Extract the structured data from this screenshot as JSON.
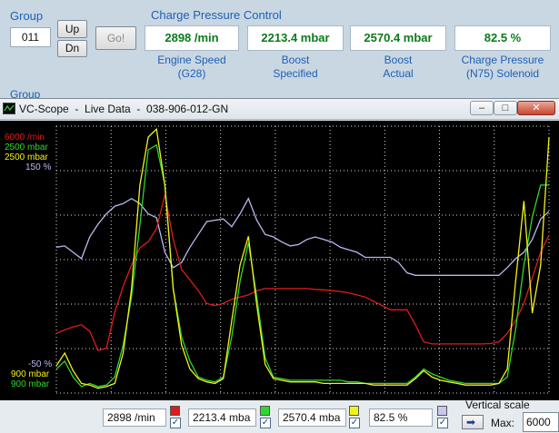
{
  "group": {
    "label": "Group",
    "value": "011",
    "up": "Up",
    "dn": "Dn",
    "go": "Go!"
  },
  "panel": {
    "title": "Charge Pressure Control",
    "fields": [
      {
        "value": "2898 /min",
        "caption1": "Engine Speed",
        "caption2": "(G28)"
      },
      {
        "value": "2213.4 mbar",
        "caption1": "Boost",
        "caption2": "Specified"
      },
      {
        "value": "2570.4 mbar",
        "caption1": "Boost",
        "caption2": "Actual"
      },
      {
        "value": "82.5 %",
        "caption1": "Charge Pressure",
        "caption2": "(N75) Solenoid"
      }
    ]
  },
  "behind_label": "Group",
  "scope": {
    "title": "VC-Scope  -  Live Data  -  038-906-012-GN",
    "app_icon": "scope-icon",
    "buttons": {
      "minimize": "–",
      "maximize": "□",
      "close": "✕"
    },
    "axis_top": [
      "6000 /min",
      "2500 mbar",
      "2500 mbar",
      "150 %"
    ],
    "axis_bottom": [
      "-50 %",
      "900 mbar",
      "900 mbar"
    ],
    "colors": {
      "rpm": "#e01b1b",
      "boost_spec": "#2fd72f",
      "boost_act": "#f2f21a",
      "n75": "#b9b9f0"
    },
    "readouts": [
      {
        "value": "2898 /min",
        "color": "#e01b1b"
      },
      {
        "value": "2213.4 mba",
        "color": "#2fd72f"
      },
      {
        "value": "2570.4 mba",
        "color": "#f2f21a"
      },
      {
        "value": "82.5 %",
        "color": "#c8c8f0"
      }
    ],
    "vertical_scale": {
      "label": "Vertical scale",
      "max_label": "Max:",
      "max_value": "6000"
    }
  },
  "chart_data": {
    "type": "line",
    "series": [
      {
        "color": "#e01b1b",
        "ylim": [
          0,
          6000
        ],
        "values": [
          1400,
          1480,
          1550,
          1600,
          1450,
          1000,
          1050,
          1900,
          2500,
          3000,
          3400,
          3550,
          3850,
          4650,
          3600,
          2900,
          2650,
          2400,
          2100,
          2050,
          2100,
          2200,
          2250,
          2300,
          2400,
          2450,
          2450,
          2450,
          2450,
          2450,
          2450,
          2430,
          2420,
          2400,
          2380,
          2350,
          2300,
          2250,
          2150,
          2050,
          1950,
          1950,
          1950,
          1600,
          1200,
          1150,
          1150,
          1150,
          1150,
          1150,
          1150,
          1150,
          1160,
          1200,
          1400,
          1700,
          2100,
          2700,
          3300,
          3700
        ]
      },
      {
        "color": "#2fd72f",
        "ylim": [
          900,
          2500
        ],
        "values": [
          1050,
          1100,
          1000,
          940,
          960,
          940,
          950,
          1000,
          1200,
          1500,
          1950,
          2420,
          2450,
          2200,
          1550,
          1250,
          1100,
          1000,
          980,
          970,
          1000,
          1250,
          1600,
          1840,
          1500,
          1120,
          1000,
          990,
          980,
          980,
          980,
          980,
          980,
          980,
          980,
          970,
          970,
          960,
          960,
          960,
          960,
          960,
          960,
          1000,
          1050,
          1020,
          1000,
          980,
          970,
          960,
          960,
          960,
          960,
          960,
          1000,
          1300,
          1700,
          2000,
          2200,
          2200
        ]
      },
      {
        "color": "#f2f21a",
        "ylim": [
          900,
          2500
        ],
        "values": [
          1070,
          1150,
          1040,
          960,
          950,
          930,
          940,
          960,
          1150,
          1550,
          2200,
          2500,
          2550,
          2200,
          1550,
          1200,
          1050,
          990,
          970,
          960,
          990,
          1350,
          1700,
          1880,
          1450,
          1080,
          990,
          980,
          970,
          970,
          970,
          970,
          960,
          960,
          960,
          960,
          960,
          960,
          950,
          950,
          950,
          950,
          950,
          990,
          1040,
          1000,
          980,
          970,
          960,
          950,
          950,
          950,
          950,
          960,
          1050,
          1600,
          2100,
          1400,
          1700,
          2500
        ]
      },
      {
        "color": "#b9b9f0",
        "ylim": [
          -50,
          150
        ],
        "values": [
          64,
          65,
          60,
          55,
          72,
          82,
          90,
          96,
          98,
          102,
          98,
          90,
          87,
          60,
          48,
          52,
          64,
          74,
          84,
          85,
          86,
          80,
          90,
          102,
          85,
          74,
          72,
          68,
          65,
          66,
          70,
          72,
          70,
          68,
          64,
          62,
          60,
          56,
          56,
          56,
          56,
          52,
          44,
          42,
          42,
          42,
          42,
          42,
          42,
          42,
          42,
          42,
          42,
          42,
          48,
          55,
          60,
          70,
          86,
          92
        ]
      }
    ]
  }
}
